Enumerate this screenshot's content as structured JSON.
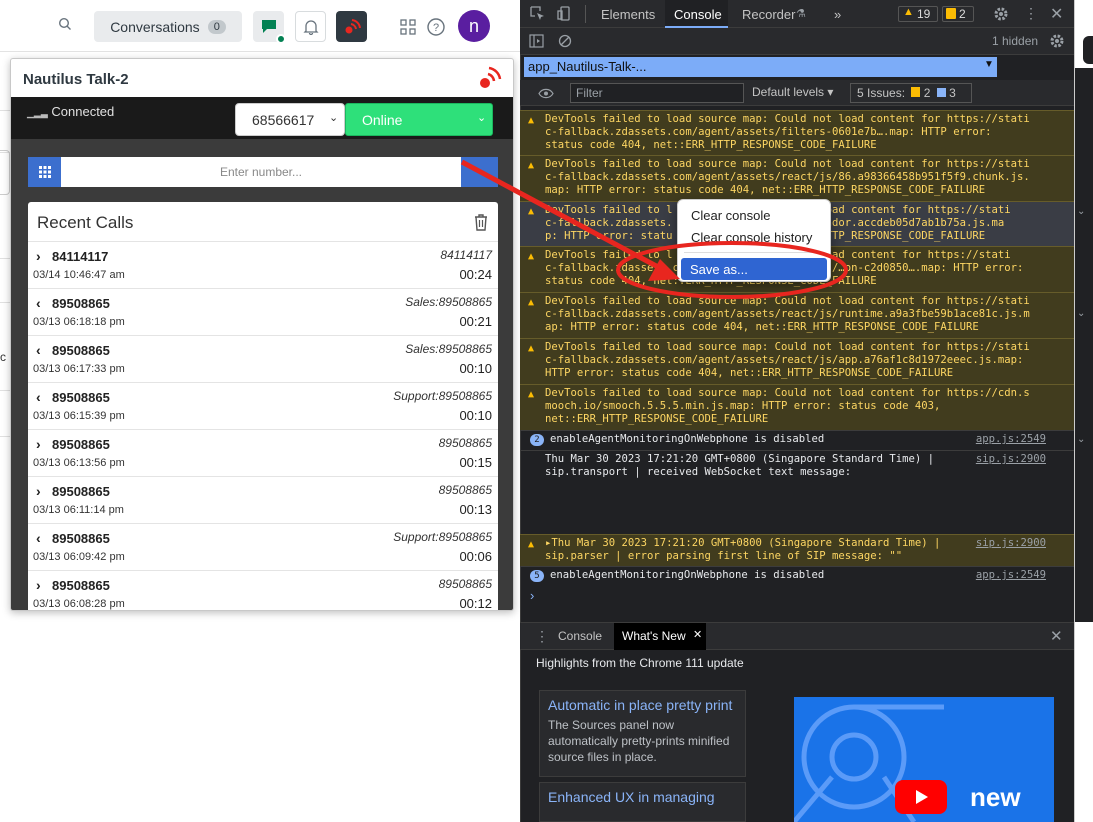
{
  "topbar": {
    "conversations_label": "Conversations",
    "conversations_count": "0",
    "avatar_initial": "n"
  },
  "widget": {
    "title": "Nautilus Talk-2",
    "connection": "Connected",
    "extension": "68566617",
    "status": "Online",
    "number_placeholder": "Enter number...",
    "recent_title": "Recent Calls",
    "calls": [
      {
        "dir": "out",
        "number": "84114117",
        "date": "03/14 10:46:47 am",
        "to": "84114117",
        "duration": "00:24"
      },
      {
        "dir": "in",
        "number": "89508865",
        "date": "03/13 06:18:18 pm",
        "to": "Sales:89508865",
        "duration": "00:21"
      },
      {
        "dir": "in",
        "number": "89508865",
        "date": "03/13 06:17:33 pm",
        "to": "Sales:89508865",
        "duration": "00:10"
      },
      {
        "dir": "in",
        "number": "89508865",
        "date": "03/13 06:15:39 pm",
        "to": "Support:89508865",
        "duration": "00:10"
      },
      {
        "dir": "out",
        "number": "89508865",
        "date": "03/13 06:13:56 pm",
        "to": "89508865",
        "duration": "00:15"
      },
      {
        "dir": "out",
        "number": "89508865",
        "date": "03/13 06:11:14 pm",
        "to": "89508865",
        "duration": "00:13"
      },
      {
        "dir": "in",
        "number": "89508865",
        "date": "03/13 06:09:42 pm",
        "to": "Support:89508865",
        "duration": "00:06"
      },
      {
        "dir": "out",
        "number": "89508865",
        "date": "03/13 06:08:28 pm",
        "to": "89508865",
        "duration": "00:12"
      }
    ]
  },
  "devtools": {
    "tabs": [
      "Elements",
      "Console",
      "Recorder",
      "»"
    ],
    "warnings_count": "19",
    "errors_count": "2",
    "hidden_label": "1 hidden",
    "context": "app_Nautilus-Talk-...",
    "filter_placeholder": "Filter",
    "levels_label": "Default levels ▾",
    "issues_label": "5 Issues:",
    "issues_warn": "2",
    "issues_info": "3",
    "messages": [
      {
        "kind": "warn",
        "lines": [
          "DevTools failed to load source map: Could not load content for https://stati",
          "c-fallback.zdassets.com/agent/assets/filters-0601e7b….map: HTTP error:",
          "status code 404, net::ERR_HTTP_RESPONSE_CODE_FAILURE"
        ]
      },
      {
        "kind": "warn",
        "lines": [
          "DevTools failed to load source map: Could not load content for https://stati",
          "c-fallback.zdassets.com/agent/assets/react/js/86.a98366458b951f5f9.chunk.js.",
          "map: HTTP error: status code 404, net::ERR_HTTP_RESPONSE_CODE_FAILURE"
        ]
      },
      {
        "kind": "warn",
        "lines": [
          "DevTools failed to l                   not load content for https://stati",
          "c-fallback.zdassets.                   js/vendor.accdeb05d7ab1b75a.js.ma",
          "p: HTTP error: statu                   ERR_HTTP_RESPONSE_CODE_FAILURE"
        ]
      },
      {
        "kind": "warn",
        "lines": [
          "DevTools failed to l                   not load content for https://stati",
          "c-fallback.zdassets.com/agent/assets/react/js/…on-c2d0850….map: HTTP error:",
          "status code 404, net::ERR_HTTP_RESPONSE_CODE_FAILURE"
        ]
      },
      {
        "kind": "warn",
        "lines": [
          "DevTools failed to load source map: Could not load content for https://stati",
          "c-fallback.zdassets.com/agent/assets/react/js/runtime.a9a3fbe59b1ace81c.js.m",
          "ap: HTTP error: status code 404, net::ERR_HTTP_RESPONSE_CODE_FAILURE"
        ]
      },
      {
        "kind": "warn",
        "lines": [
          "DevTools failed to load source map: Could not load content for https://stati",
          "c-fallback.zdassets.com/agent/assets/react/js/app.a76af1c8d1972eeec.js.map:",
          "HTTP error: status code 404, net::ERR_HTTP_RESPONSE_CODE_FAILURE"
        ]
      },
      {
        "kind": "warn",
        "lines": [
          "DevTools failed to load source map: Could not load content for https://cdn.s",
          "mooch.io/smooch.5.5.5.min.js.map: HTTP error: status code 403,",
          "net::ERR_HTTP_RESPONSE_CODE_FAILURE"
        ]
      },
      {
        "kind": "info",
        "badge": "2",
        "lines": [
          "enableAgentMonitoringOnWebphone is disabled"
        ],
        "src": "app.js:2549"
      },
      {
        "kind": "info",
        "lines": [
          "Thu Mar 30 2023 17:21:20 GMT+0800 (Singapore Standard Time) |",
          "sip.transport | received WebSocket text message:"
        ],
        "src": "sip.js:2900"
      },
      {
        "kind": "warn",
        "lines": [
          "▸Thu Mar 30 2023 17:21:20 GMT+0800 (Singapore Standard Time) |",
          "sip.parser | error parsing first line of SIP message: \"\""
        ],
        "src": "sip.js:2900"
      },
      {
        "kind": "info",
        "badge": "5",
        "lines": [
          "enableAgentMonitoringOnWebphone is disabled"
        ],
        "src": "app.js:2549"
      }
    ],
    "context_menu": {
      "clear": "Clear console",
      "clear_history": "Clear console history",
      "save": "Save as..."
    },
    "drawer": {
      "tab_console": "Console",
      "tab_whatsnew": "What's New",
      "highlights": "Highlights from the Chrome 111 update",
      "card1_title": "Automatic in place pretty print",
      "card1_body": "The Sources panel now automatically pretty-prints minified source files in place.",
      "card2_title": "Enhanced UX in managing",
      "video_text": "new"
    }
  },
  "colors": {
    "online": "#2ee07a",
    "accent_blue": "#3c6fce",
    "annotation_red": "#e8261f",
    "menu_highlight": "#2f65d2"
  }
}
